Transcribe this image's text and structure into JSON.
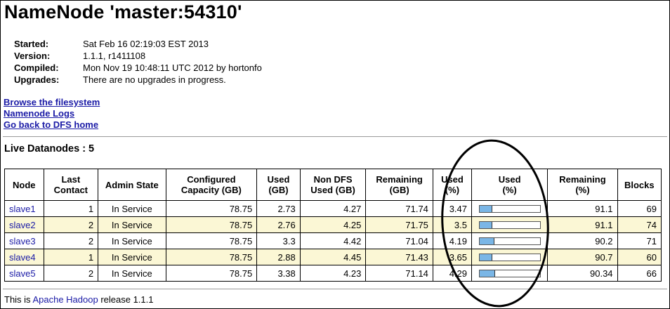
{
  "page": {
    "title": "NameNode 'master:54310'"
  },
  "info": [
    {
      "label": "Started:",
      "value": "Sat Feb 16 02:19:03 EST 2013"
    },
    {
      "label": "Version:",
      "value": "1.1.1, r1411108"
    },
    {
      "label": "Compiled:",
      "value": "Mon Nov 19 10:48:11 UTC 2012 by hortonfo"
    },
    {
      "label": "Upgrades:",
      "value": "There are no upgrades in progress."
    }
  ],
  "links": {
    "browse": "Browse the filesystem",
    "logs": "Namenode Logs",
    "home": "Go back to DFS home"
  },
  "live_heading": "Live Datanodes : 5",
  "table": {
    "headers": [
      [
        "Node"
      ],
      [
        "Last",
        "Contact"
      ],
      [
        "Admin State"
      ],
      [
        "Configured",
        "Capacity (GB)"
      ],
      [
        "Used",
        "(GB)"
      ],
      [
        "Non DFS",
        "Used (GB)"
      ],
      [
        "Remaining",
        "(GB)"
      ],
      [
        "Used",
        "(%)"
      ],
      [
        "Used",
        "(%)"
      ],
      [
        "Remaining",
        "(%)"
      ],
      [
        "Blocks"
      ]
    ],
    "rows": [
      {
        "node": "slave1",
        "contact": "1",
        "state": "In Service",
        "capacity": "78.75",
        "used": "2.73",
        "nondfs": "4.27",
        "remaining": "71.74",
        "used_pct": "3.47",
        "used_pct_value": 3.47,
        "remaining_pct": "91.1",
        "blocks": "69"
      },
      {
        "node": "slave2",
        "contact": "2",
        "state": "In Service",
        "capacity": "78.75",
        "used": "2.76",
        "nondfs": "4.25",
        "remaining": "71.75",
        "used_pct": "3.5",
        "used_pct_value": 3.5,
        "remaining_pct": "91.1",
        "blocks": "74"
      },
      {
        "node": "slave3",
        "contact": "2",
        "state": "In Service",
        "capacity": "78.75",
        "used": "3.3",
        "nondfs": "4.42",
        "remaining": "71.04",
        "used_pct": "4.19",
        "used_pct_value": 4.19,
        "remaining_pct": "90.2",
        "blocks": "71"
      },
      {
        "node": "slave4",
        "contact": "1",
        "state": "In Service",
        "capacity": "78.75",
        "used": "2.88",
        "nondfs": "4.45",
        "remaining": "71.43",
        "used_pct": "3.65",
        "used_pct_value": 3.65,
        "remaining_pct": "90.7",
        "blocks": "60"
      },
      {
        "node": "slave5",
        "contact": "2",
        "state": "In Service",
        "capacity": "78.75",
        "used": "3.38",
        "nondfs": "4.23",
        "remaining": "71.14",
        "used_pct": "4.29",
        "used_pct_value": 4.29,
        "remaining_pct": "90.34",
        "blocks": "66"
      }
    ]
  },
  "footer": {
    "prefix": "This is ",
    "link": "Apache Hadoop",
    "suffix": " release 1.1.1"
  },
  "colors": {
    "link": "#1a1aa6",
    "row_highlight": "#fbf7d5",
    "bar_fill": "#7ab6e6"
  }
}
